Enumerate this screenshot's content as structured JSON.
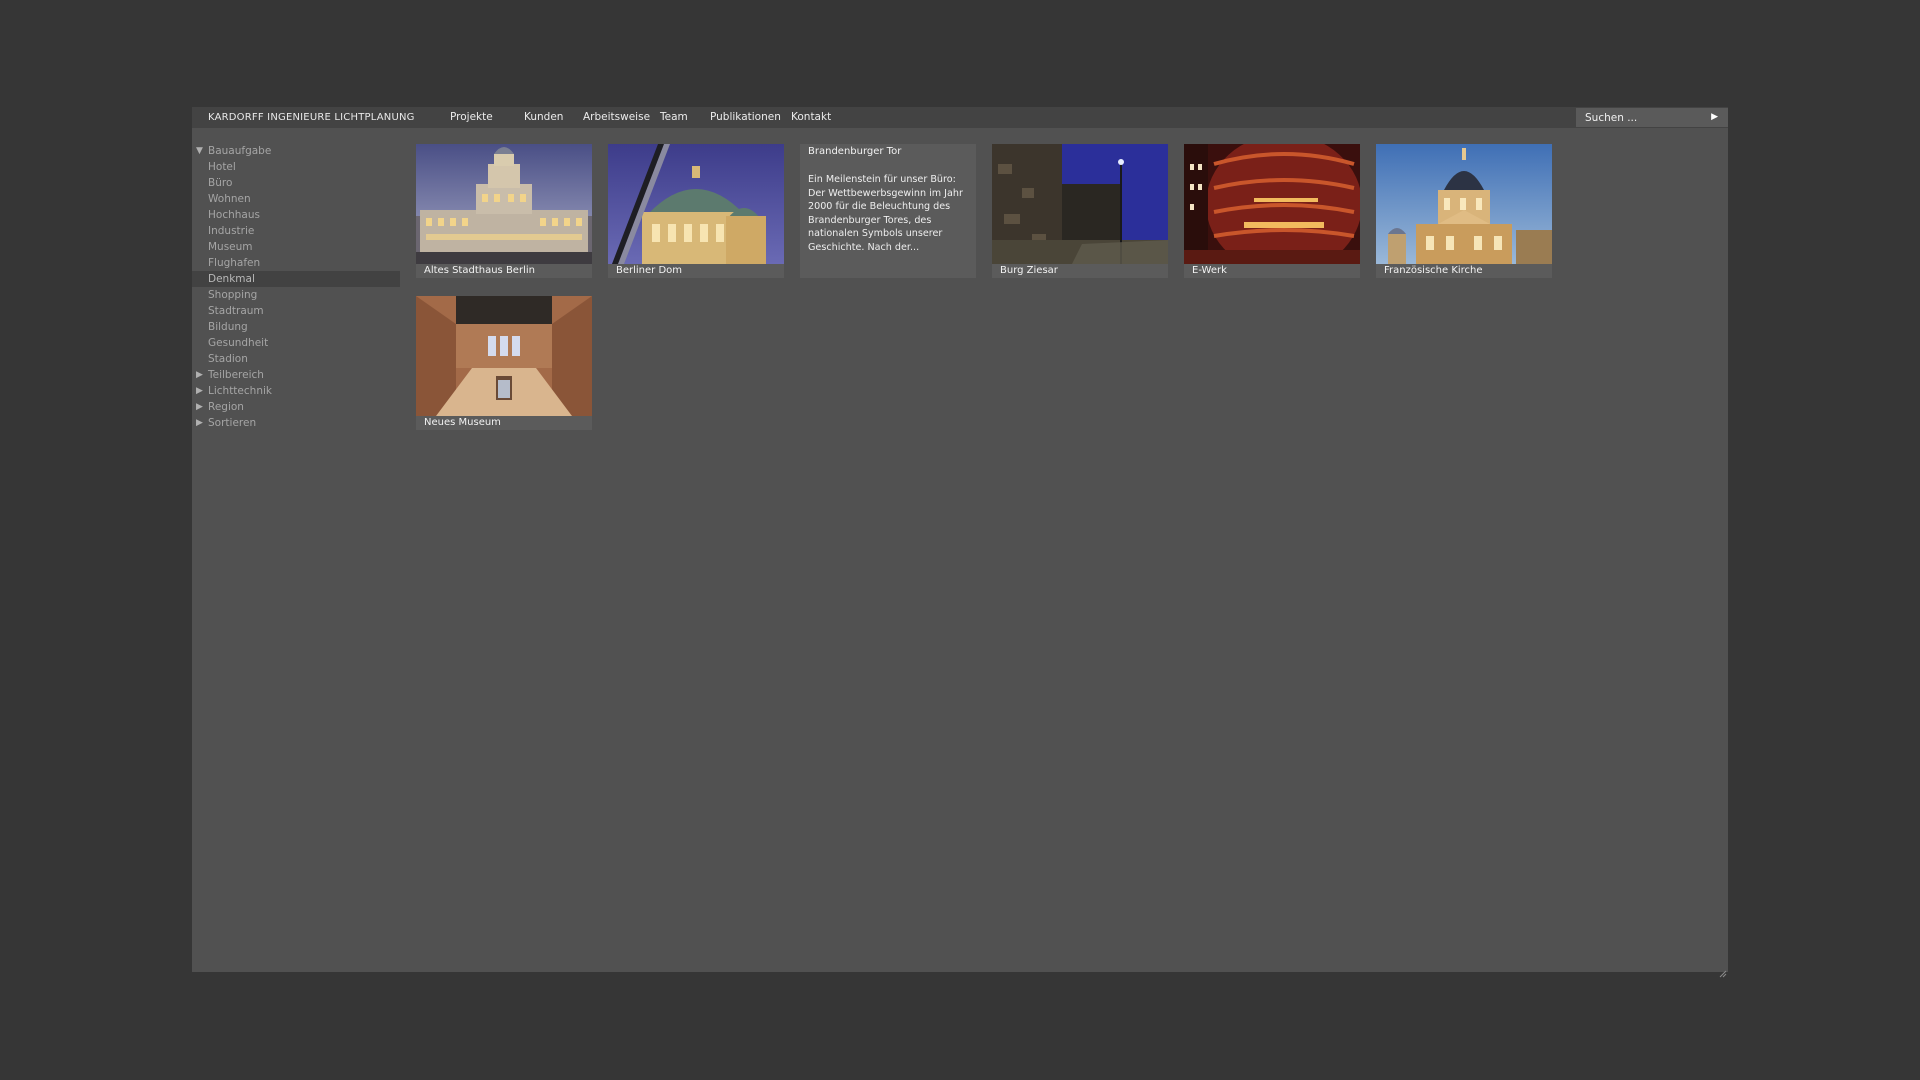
{
  "header": {
    "brand": "KARDORFF INGENIEURE LICHTPLANUNG",
    "nav": [
      "Projekte",
      "Kunden",
      "Arbeitsweise",
      "Team",
      "Publikationen",
      "Kontakt"
    ],
    "search_placeholder": "Suchen ...",
    "search_go": "▶"
  },
  "sidebar": {
    "section": {
      "arrow": "▼",
      "label": "Bauaufgabe"
    },
    "items": [
      "Hotel",
      "Büro",
      "Wohnen",
      "Hochhaus",
      "Industrie",
      "Museum",
      "Flughafen",
      "Denkmal",
      "Shopping",
      "Stadtraum",
      "Bildung",
      "Gesundheit",
      "Stadion"
    ],
    "active_item": "Denkmal",
    "collapsed": [
      {
        "arrow": "▶",
        "label": "Teilbereich"
      },
      {
        "arrow": "▶",
        "label": "Lichttechnik"
      },
      {
        "arrow": "▶",
        "label": "Region"
      },
      {
        "arrow": "▶",
        "label": "Sortieren"
      }
    ]
  },
  "projects": [
    {
      "title": "Altes Stadthaus Berlin"
    },
    {
      "title": "Berliner Dom"
    },
    {
      "title": "Brandenburger Tor",
      "text": "Ein Meilenstein für unser Büro: Der Wettbewerbsgewinn im Jahr 2000 für die Beleuchtung des Brandenburger Tores, des nationalen Symbols unserer Geschichte. Nach der..."
    },
    {
      "title": "Burg Ziesar"
    },
    {
      "title": "E-Werk"
    },
    {
      "title": "Französische Kirche"
    },
    {
      "title": "Neues Museum"
    }
  ],
  "colors": {
    "page_bg": "#363636",
    "panel_bg": "#515151",
    "topbar_bg": "#434343",
    "active_bg": "#424242",
    "text_muted": "#a5a5a5",
    "text_light": "#f2f2f2"
  }
}
